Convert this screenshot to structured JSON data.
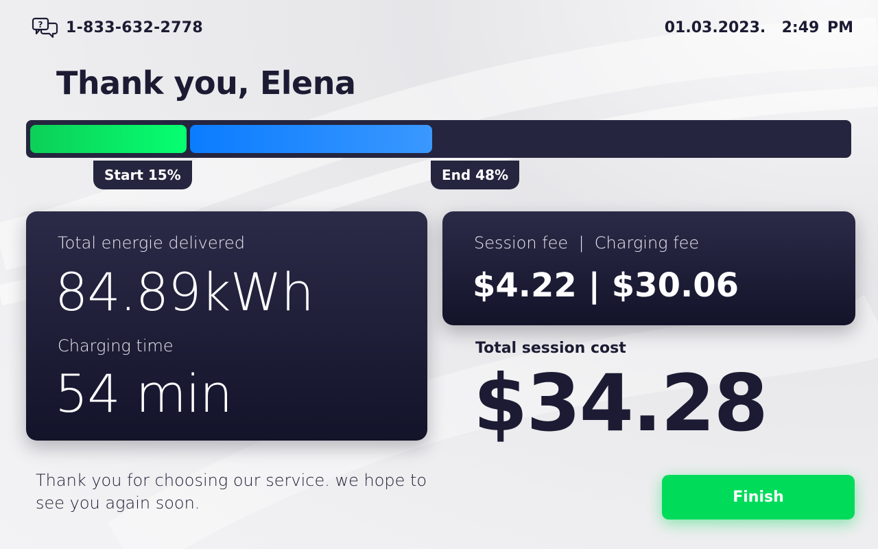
{
  "header": {
    "support_icon": "chat-help-icon",
    "phone": "1-833-632-2778",
    "datetime": "01.03.2023.  2:49 PM"
  },
  "greeting": "Thank you, Elena",
  "battery": {
    "start_percent": 15,
    "end_percent": 48,
    "start_label": "Start 15%",
    "end_label": "End 48%",
    "colors": {
      "start": "#0cf064",
      "added": "#1f8cff",
      "track": "#25253f"
    }
  },
  "energy_card": {
    "energy_label": "Total energie delivered",
    "energy_value": "84.89kWh",
    "time_label": "Charging time",
    "time_value": "54 min"
  },
  "fees_card": {
    "label": "Session fee  |  Charging fee",
    "value": "$4.22 | $30.06"
  },
  "total": {
    "label": "Total session cost",
    "value": "$34.28"
  },
  "thanks_message": "Thank you for choosing our service. we hope to see you again soon.",
  "finish_button": {
    "label": "Finish",
    "color": "#00dc5a"
  }
}
